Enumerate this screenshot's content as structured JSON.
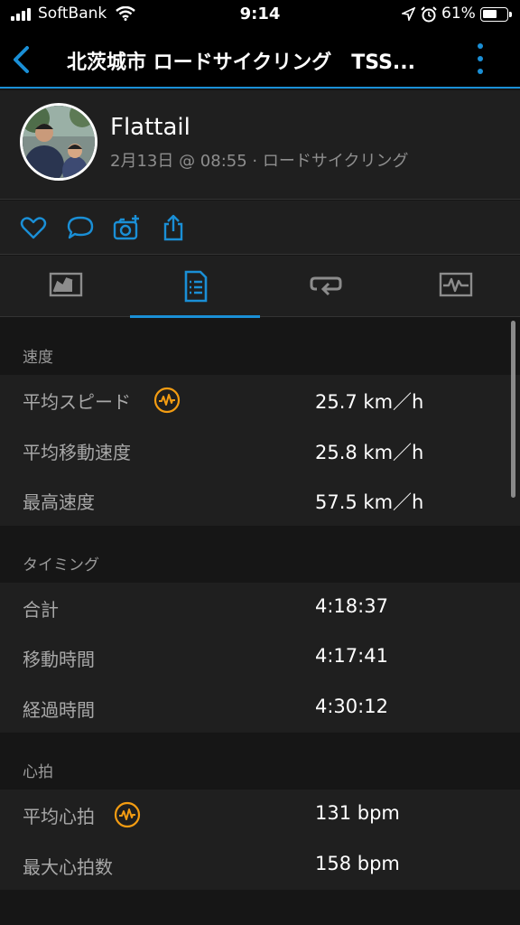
{
  "status_bar": {
    "carrier": "SoftBank",
    "time": "9:14",
    "battery_percent": "61%",
    "battery_level": 0.61
  },
  "nav": {
    "title": "北茨城市 ロードサイクリング　TSS...",
    "back_icon": "chevron-left-icon",
    "more_icon": "vertical-dots-icon"
  },
  "profile": {
    "name": "Flattail",
    "meta": "2月13日 @ 08:55 · ロードサイクリング"
  },
  "actions": [
    "heart-icon",
    "comment-icon",
    "add-photo-icon",
    "share-icon"
  ],
  "tabs": [
    {
      "icon": "map-chart-icon",
      "active": false
    },
    {
      "icon": "document-list-icon",
      "active": true
    },
    {
      "icon": "laps-repeat-icon",
      "active": false
    },
    {
      "icon": "activity-graph-icon",
      "active": false
    }
  ],
  "sections": {
    "speed": {
      "title": "速度",
      "rows": [
        {
          "label": "平均スピード",
          "value": "25.7 km／h",
          "badge": true
        },
        {
          "label": "平均移動速度",
          "value": "25.8 km／h"
        },
        {
          "label": "最高速度",
          "value": "57.5 km／h"
        }
      ]
    },
    "timing": {
      "title": "タイミング",
      "rows": [
        {
          "label": "合計",
          "value": "4:18:37"
        },
        {
          "label": "移動時間",
          "value": "4:17:41"
        },
        {
          "label": "経過時間",
          "value": "4:30:12"
        }
      ]
    },
    "heart_rate": {
      "title": "心拍",
      "rows": [
        {
          "label": "平均心拍",
          "value": "131 bpm",
          "badge": true
        },
        {
          "label": "最大心拍数",
          "value": "158 bpm"
        }
      ]
    }
  },
  "colors": {
    "accent": "#1a8fd6",
    "badge": "#f39c12",
    "background": "#161616",
    "panel": "#1f1f1f"
  }
}
